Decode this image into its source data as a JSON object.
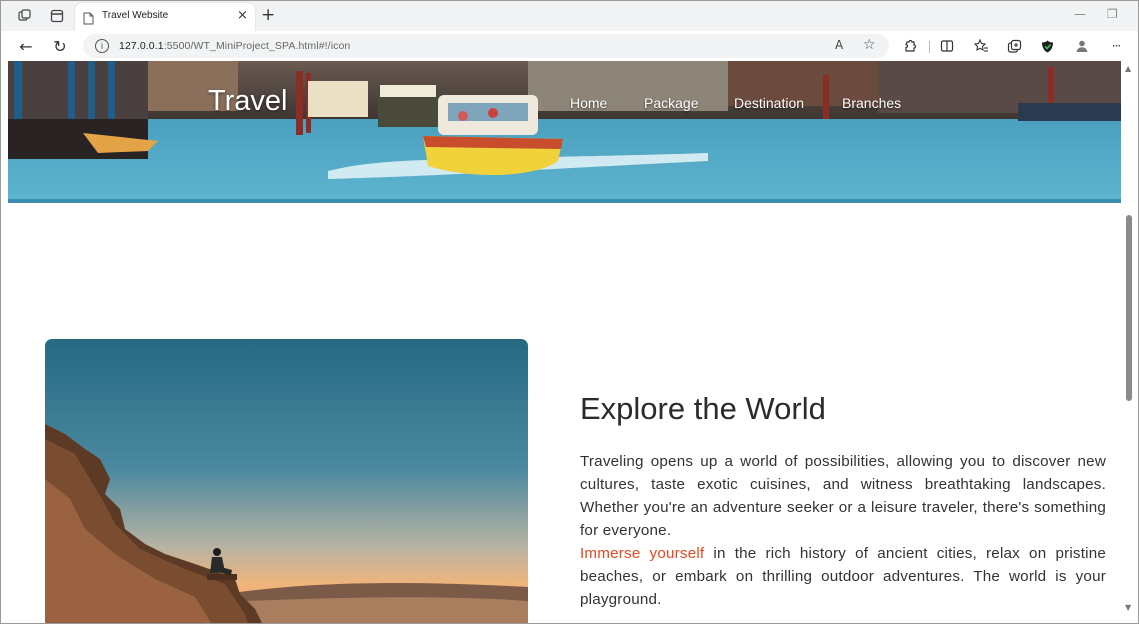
{
  "browser": {
    "tab_title": "Travel Website",
    "url_host": "127.0.0.1",
    "url_rest": ":5500/WT_MiniProject_SPA.html#!/icon",
    "icons": {
      "collections": "collections-icon",
      "tab_actions": "tab-actions-icon",
      "page": "page-icon",
      "close": "close-icon",
      "new_tab": "plus-icon",
      "back": "back-arrow-icon",
      "refresh": "refresh-icon",
      "info": "info-icon",
      "read_aloud": "read-aloud-icon",
      "favorite": "star-icon",
      "extensions": "extensions-icon",
      "split": "split-screen-icon",
      "favorites_bar": "favorites-icon",
      "collections_btn": "collections-icon",
      "shield": "browser-essentials-icon",
      "profile": "profile-icon",
      "more": "more-icon"
    },
    "glyphs": {
      "close": "×",
      "new_tab": "+",
      "minimize": "—",
      "restore": "❐",
      "back": "←",
      "refresh": "↻",
      "info": "i",
      "read_aloud": "A",
      "favorite": "☆",
      "more": "···"
    }
  },
  "site": {
    "brand": "Travel",
    "nav": [
      "Home",
      "Package",
      "Destination",
      "Branches"
    ],
    "heading": "Explore the World",
    "para1": "Traveling opens up a world of possibilities, allowing you to discover new cultures, taste exotic cuisines, and witness breathtaking landscapes. Whether you're an adventure seeker or a leisure traveler, there's something for everyone.",
    "highlight": "Immerse yourself",
    "para2_rest": " in the rich history of ancient cities, relax on pristine beaches, or embark on thrilling outdoor adventures. The world is your playground."
  },
  "colors": {
    "highlight": "#e8471f",
    "heading": "#2b2b2b",
    "body": "#333333"
  }
}
